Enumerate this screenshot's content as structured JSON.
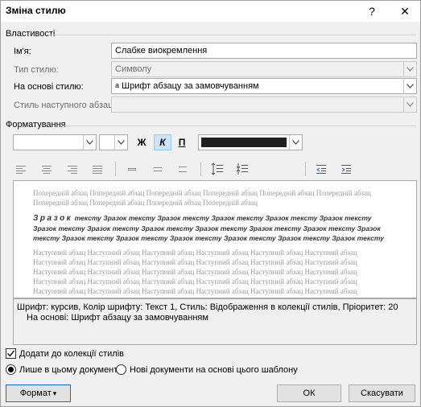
{
  "window": {
    "title": "Зміна стилю",
    "help_label": "?",
    "close_label": "✕"
  },
  "properties": {
    "section_label": "Властивості",
    "name_label": "Ім'я:",
    "name_value": "Слабке виокремлення",
    "style_type_label": "Тип стилю:",
    "style_type_value": "Символу",
    "based_on_label": "На основі стилю:",
    "based_on_glyph": "a",
    "based_on_value": "Шрифт абзацу за замовчуванням",
    "next_style_label": "Стиль наступного абзацу:",
    "next_style_value": ""
  },
  "formatting": {
    "section_label": "Форматування",
    "font_value": "",
    "size_value": "",
    "bold_label": "Ж",
    "italic_label": "К",
    "underline_label": "П",
    "font_color": "#1f1f1f"
  },
  "preview": {
    "previous_text": "Попередній абзац Попередній абзац Попередній абзац Попередній абзац Попередній абзац Попередній абзац Попередній абзац Попередній абзац Попередній абзац Попередній абзац",
    "sample_lead": "Зразок",
    "sample_text": " тексту Зразок тексту Зразок тексту Зразок тексту Зразок тексту Зразок тексту Зразок тексту Зразок тексту Зразок тексту Зразок тексту Зразок тексту Зразок тексту Зразок тексту Зразок тексту Зразок тексту Зразок тексту Зразок тексту Зразок тексту Зразок тексту",
    "next_text": "Наступний абзац Наступний абзац Наступний абзац Наступний абзац Наступний абзац Наступний абзац Наступний абзац Наступний абзац Наступний абзац Наступний абзац Наступний абзац Наступний абзац Наступний абзац Наступний абзац Наступний абзац Наступний абзац Наступний абзац Наступний абзац Наступний абзац Наступний абзац Наступний абзац Наступний абзац Наступний абзац Наступний абзац Наступний абзац Наступний абзац Наступний абзац Наступний абзац Наступний абзац Наступний абзац Наступний абзац Наступний абзац Наступний абзац Наступний абзац Наступний абзац Наступний абзац"
  },
  "description": {
    "line1": "Шрифт: курсив, Колір шрифту: Текст 1, Стиль: Відображення в колекції стилів, Пріоритет: 20",
    "line2": "На основі: Шрифт абзацу за замовчуванням"
  },
  "options": {
    "add_to_gallery_label": "Додати до колекції стилів",
    "add_to_gallery_checked": true,
    "only_this_doc_label": "Лише в цьому документі",
    "new_docs_label": "Нові документи на основі цього шаблону",
    "selected_scope": "only_this_doc"
  },
  "buttons": {
    "format_label": "Формат",
    "format_caret": "▾",
    "ok_label": "ОК",
    "cancel_label": "Скасувати"
  },
  "icons": {
    "align": [
      "align-left-icon",
      "align-center-icon",
      "align-right-icon",
      "justify-icon",
      "single-spacing-icon",
      "one-half-spacing-icon",
      "double-spacing-icon",
      "increase-paragraph-spacing-icon",
      "decrease-paragraph-spacing-icon",
      "decrease-indent-icon",
      "increase-indent-icon"
    ]
  }
}
